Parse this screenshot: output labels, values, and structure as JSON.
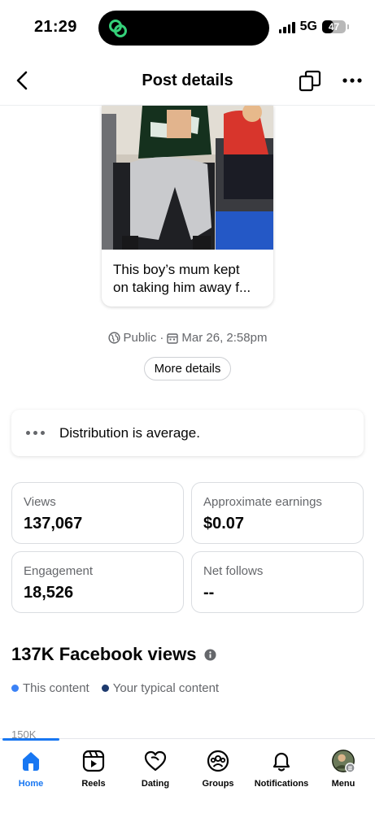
{
  "status_bar": {
    "time": "21:29",
    "network": "5G",
    "battery": "47",
    "battery_level_percent": 47
  },
  "header": {
    "title": "Post details",
    "back_icon": "chevron-left-icon",
    "copy_icon": "copy-icon",
    "more_icon": "ellipsis-icon"
  },
  "post": {
    "caption_line1": "This boy’s mum kept",
    "caption_line2": "on taking him away f..."
  },
  "meta": {
    "visibility": "Public",
    "separator": "·",
    "date": "Mar 26, 2:58pm",
    "more_details_label": "More details"
  },
  "distribution": {
    "text": "Distribution is average."
  },
  "stats": {
    "views": {
      "label": "Views",
      "value": "137,067"
    },
    "earnings": {
      "label": "Approximate earnings",
      "value": "$0.07"
    },
    "engagement": {
      "label": "Engagement",
      "value": "18,526"
    },
    "net_follows": {
      "label": "Net follows",
      "value": "--"
    }
  },
  "views_section": {
    "title": "137K Facebook views",
    "legend_this": "This content",
    "legend_typical": "Your typical content",
    "y_tick_top": "150K"
  },
  "colors": {
    "accent": "#1877f2",
    "this_content": "#3b82f6",
    "typical_content": "#1d3a6e",
    "secondary_text": "#65676b"
  },
  "nav": {
    "home": "Home",
    "reels": "Reels",
    "dating": "Dating",
    "groups": "Groups",
    "notifications": "Notifications",
    "menu": "Menu"
  }
}
